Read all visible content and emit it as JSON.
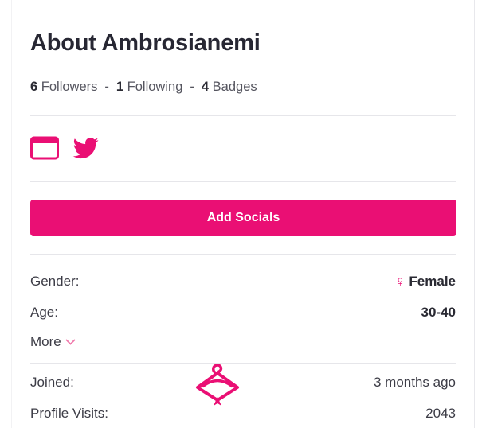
{
  "title": "About Ambrosianemi",
  "stats": {
    "followers_count": "6",
    "followers_label": "Followers",
    "following_count": "1",
    "following_label": "Following",
    "badges_count": "4",
    "badges_label": "Badges",
    "separator": "-"
  },
  "socials": {
    "icons": [
      "website-icon",
      "twitter-icon"
    ],
    "add_button_label": "Add Socials"
  },
  "details": {
    "gender_label": "Gender:",
    "gender_value": "Female",
    "gender_icon": "female-symbol-icon",
    "age_label": "Age:",
    "age_value": "30-40",
    "more_label": "More",
    "joined_label": "Joined:",
    "joined_value": "3 months ago",
    "visits_label": "Profile Visits:",
    "visits_value": "2043"
  },
  "colors": {
    "accent": "#ea0f74",
    "text_dark": "#272733",
    "divider": "#e6e6ea"
  }
}
